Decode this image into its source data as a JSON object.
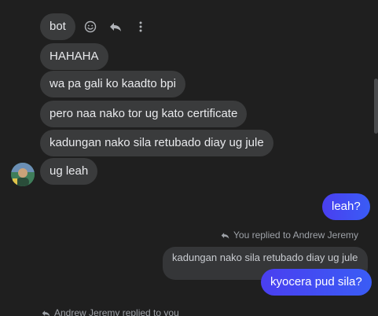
{
  "messages_incoming": [
    "bot",
    "HAHAHA",
    "wa pa gali ko kaadto bpi",
    "pero naa nako tor ug kato certificate",
    "kadungan nako sila retubado diay ug jule",
    "ug leah"
  ],
  "message_outgoing_1": "leah?",
  "reply_notice_outgoing": "You replied to Andrew Jeremy",
  "quoted_message": "kadungan nako sila retubado diay ug jule",
  "message_outgoing_2": "kyocera pud sila?",
  "reply_notice_incoming": "Andrew Jeremy replied to you",
  "icons": {
    "react": "smiley-icon",
    "reply": "reply-arrow-icon",
    "more": "more-vertical-icon"
  },
  "colors": {
    "background": "#1f1f1f",
    "incoming_bubble": "#3a3b3c",
    "outgoing_bubble": "#4a3ff0",
    "meta_text": "#9ea2a8"
  }
}
